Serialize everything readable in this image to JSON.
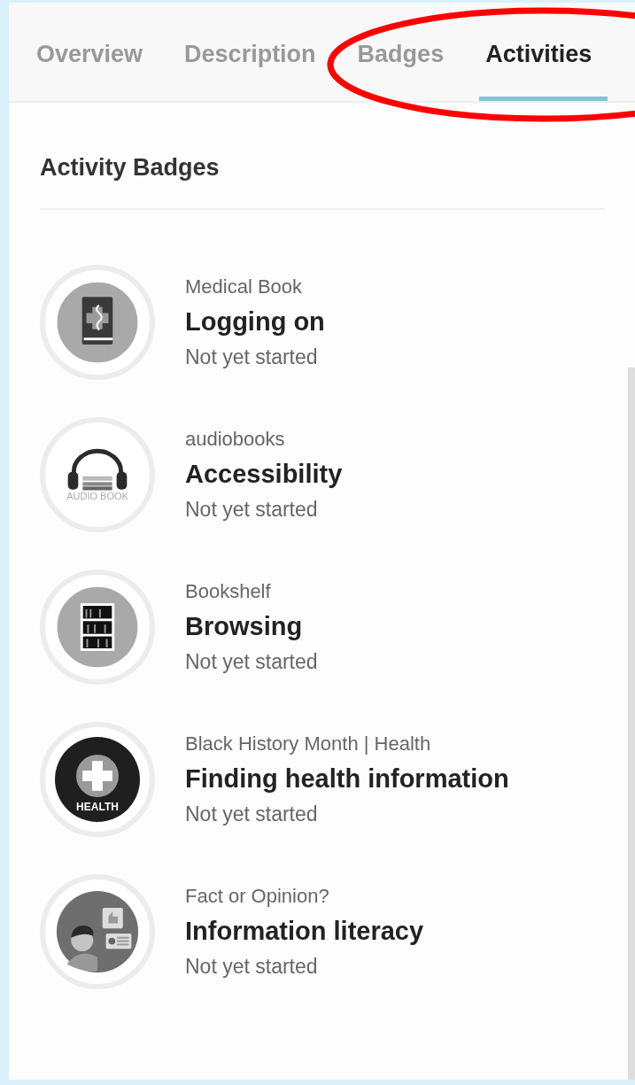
{
  "tabs": [
    {
      "label": "Overview",
      "selected": false
    },
    {
      "label": "Description",
      "selected": false
    },
    {
      "label": "Badges",
      "selected": false
    },
    {
      "label": "Activities",
      "selected": true
    }
  ],
  "annotation": {
    "kind": "ellipse",
    "color": "#ff0000"
  },
  "section": {
    "title": "Activity Badges"
  },
  "badges": [
    {
      "kind": "medical-book",
      "category": "Medical Book",
      "title": "Logging on",
      "status": "Not yet started"
    },
    {
      "kind": "audiobook",
      "icon_text": "AUDIO BOOK",
      "category": "audiobooks",
      "title": "Accessibility",
      "status": "Not yet started"
    },
    {
      "kind": "bookshelf",
      "category": "Bookshelf",
      "title": "Browsing",
      "status": "Not yet started"
    },
    {
      "kind": "health",
      "icon_text": "HEALTH",
      "category": "Black History Month | Health",
      "title": "Finding health information",
      "status": "Not yet started"
    },
    {
      "kind": "opinion",
      "category": "Fact or Opinion?",
      "title": "Information literacy",
      "status": "Not yet started"
    }
  ]
}
